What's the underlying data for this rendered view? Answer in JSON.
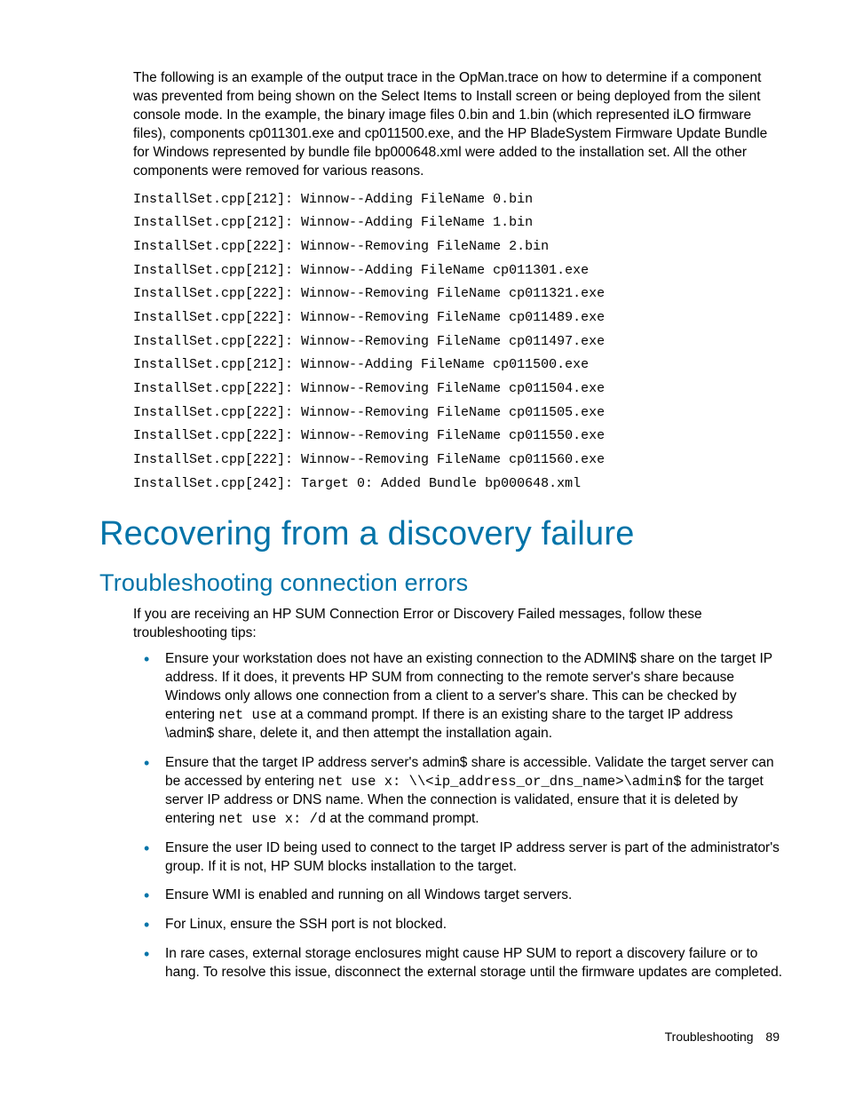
{
  "intro": "The following is an example of the output trace in the OpMan.trace on how to determine if a component was prevented from being shown on the Select Items to Install screen or being deployed from the silent console mode. In the example, the binary image files 0.bin and 1.bin (which represented iLO firmware files), components cp011301.exe and cp011500.exe, and the HP BladeSystem Firmware Update Bundle for Windows represented by bundle file bp000648.xml were added to the installation set.  All the other components were removed for various reasons.",
  "trace_lines": [
    "InstallSet.cpp[212]: Winnow--Adding FileName 0.bin",
    "InstallSet.cpp[212]: Winnow--Adding FileName 1.bin",
    "InstallSet.cpp[222]: Winnow--Removing FileName 2.bin",
    "InstallSet.cpp[212]: Winnow--Adding FileName cp011301.exe",
    "InstallSet.cpp[222]: Winnow--Removing FileName cp011321.exe",
    "InstallSet.cpp[222]: Winnow--Removing FileName cp011489.exe",
    "InstallSet.cpp[222]: Winnow--Removing FileName cp011497.exe",
    "InstallSet.cpp[212]: Winnow--Adding FileName cp011500.exe",
    "InstallSet.cpp[222]: Winnow--Removing FileName cp011504.exe",
    "InstallSet.cpp[222]: Winnow--Removing FileName cp011505.exe",
    "InstallSet.cpp[222]: Winnow--Removing FileName cp011550.exe",
    "InstallSet.cpp[222]: Winnow--Removing FileName cp011560.exe",
    "InstallSet.cpp[242]: Target 0: Added Bundle bp000648.xml"
  ],
  "h1": "Recovering from a discovery failure",
  "h2": "Troubleshooting connection errors",
  "p2": "If you are receiving an HP SUM Connection Error or Discovery Failed messages, follow these troubleshooting tips:",
  "bullets": [
    {
      "pre": "Ensure your workstation does not have an existing connection to the ADMIN$ share on the target IP address. If it does, it prevents HP SUM from connecting to the remote server's share because Windows only allows one connection from a client to a server's share. This can be checked by entering ",
      "code1": "net use",
      "mid": " at a command prompt. If there is an existing share to the target IP address \\admin$ share, delete it, and then attempt the installation again."
    },
    {
      "pre": "Ensure that the target IP address server's admin$ share is accessible. Validate the target server can be accessed by entering ",
      "code1": "net use x: \\\\<ip_address_or_dns_name>\\admin$",
      "mid": " for the target server IP address or DNS name. When the connection is validated, ensure that it is deleted by entering ",
      "code2": "net use x: /d",
      "post": " at the command prompt."
    },
    {
      "pre": "Ensure the user ID being used to connect to the target IP address server is part of the administrator's group. If it is not, HP SUM blocks installation to the target."
    },
    {
      "pre": "Ensure WMI is enabled and running on all Windows target servers."
    },
    {
      "pre": "For Linux, ensure the SSH port is not blocked."
    },
    {
      "pre": "In rare cases, external storage enclosures might cause HP SUM to report a discovery failure or to hang. To resolve this issue, disconnect the external storage until the firmware updates are completed."
    }
  ],
  "footer_label": "Troubleshooting",
  "footer_page": "89"
}
